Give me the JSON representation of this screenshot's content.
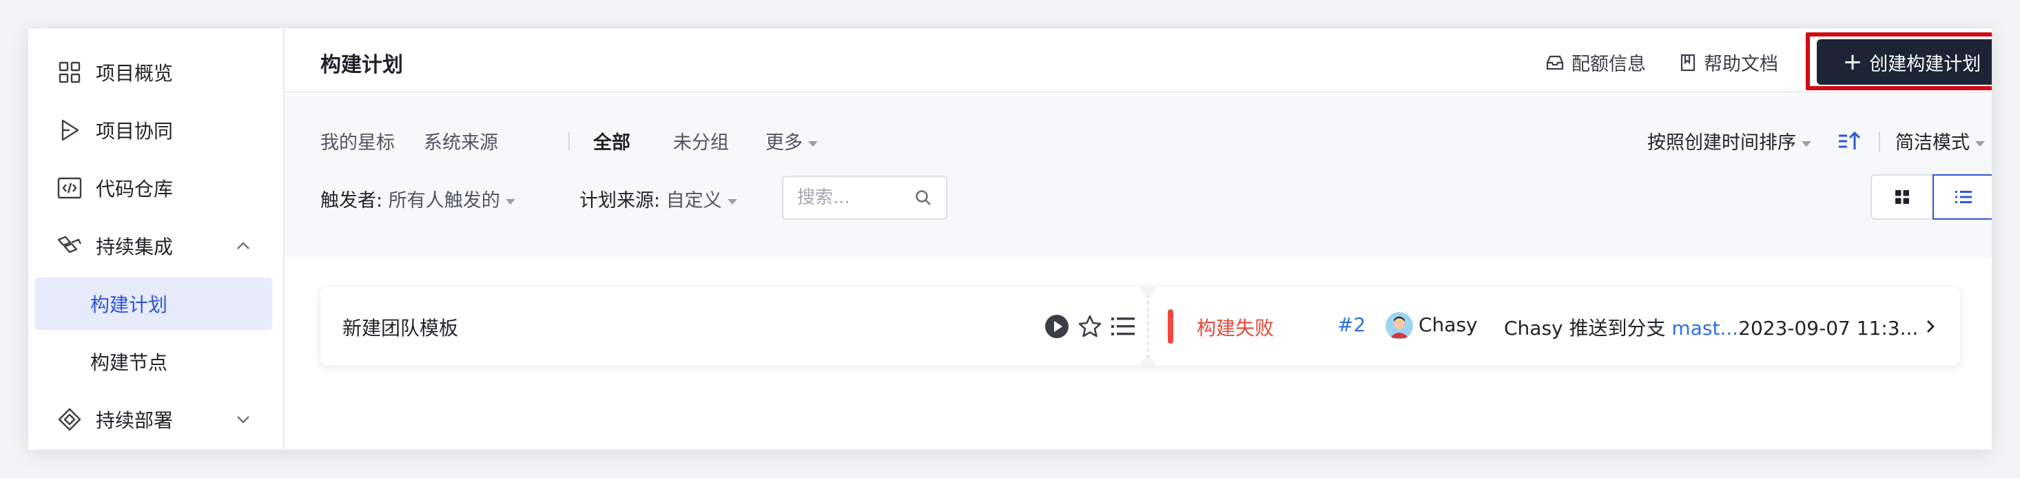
{
  "sidebar": {
    "items": [
      {
        "label": "项目概览"
      },
      {
        "label": "项目协同"
      },
      {
        "label": "代码仓库"
      },
      {
        "label": "持续集成"
      },
      {
        "label": "构建计划"
      },
      {
        "label": "构建节点"
      },
      {
        "label": "持续部署"
      }
    ]
  },
  "header": {
    "title": "构建计划",
    "quota_label": "配额信息",
    "help_label": "帮助文档",
    "create_label": "创建构建计划"
  },
  "filters": {
    "tabs": [
      {
        "label": "我的星标"
      },
      {
        "label": "系统来源"
      },
      {
        "label": "全部"
      },
      {
        "label": "未分组"
      },
      {
        "label": "更多"
      }
    ],
    "sort_label": "按照创建时间排序",
    "mode_label": "简洁模式",
    "trigger_label": "触发者:",
    "trigger_value": "所有人触发的",
    "source_label": "计划来源:",
    "source_value": "自定义",
    "search_placeholder": "搜索..."
  },
  "plan": {
    "name": "新建团队模板",
    "status": "构建失败",
    "build_number": "#2",
    "user": "Chasy",
    "commit_prefix": "Chasy 推送到分支 ",
    "branch": "mast...",
    "time": "2023-09-07 11:3..."
  },
  "colors": {
    "accent": "#2d55d8",
    "create_button": "#1d2435",
    "highlight_outline": "#d10a14",
    "failure": "#e5463b",
    "link": "#2d6fe0"
  }
}
